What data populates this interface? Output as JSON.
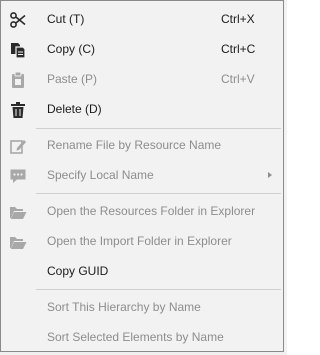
{
  "context_menu": {
    "items": [
      {
        "label": "Cut (T)",
        "shortcut": "Ctrl+X",
        "icon": "scissors-icon",
        "enabled": true
      },
      {
        "label": "Copy (C)",
        "shortcut": "Ctrl+C",
        "icon": "copy-icon",
        "enabled": true
      },
      {
        "label": "Paste (P)",
        "shortcut": "Ctrl+V",
        "icon": "paste-icon",
        "enabled": false
      },
      {
        "label": "Delete (D)",
        "shortcut": "",
        "icon": "trash-icon",
        "enabled": true
      },
      {
        "label": "Rename File by Resource Name",
        "icon": "rename-icon",
        "enabled": false
      },
      {
        "label": "Specify Local Name",
        "icon": "comment-icon",
        "enabled": false,
        "has_submenu": true
      },
      {
        "label": "Open the Resources Folder in Explorer",
        "icon": "folder-open-icon",
        "enabled": false
      },
      {
        "label": "Open the Import Folder in Explorer",
        "icon": "folder-open-icon",
        "enabled": false
      },
      {
        "label": "Copy GUID",
        "enabled": true
      },
      {
        "label": "Sort This Hierarchy by Name",
        "enabled": false
      },
      {
        "label": "Sort Selected Elements by Name",
        "enabled": false
      }
    ]
  },
  "colors": {
    "enabled_text": "#1b1b1b",
    "disabled_text": "#8d8d8d",
    "icon_enabled": "#2b2b2b",
    "icon_disabled": "#a8a8a8"
  }
}
